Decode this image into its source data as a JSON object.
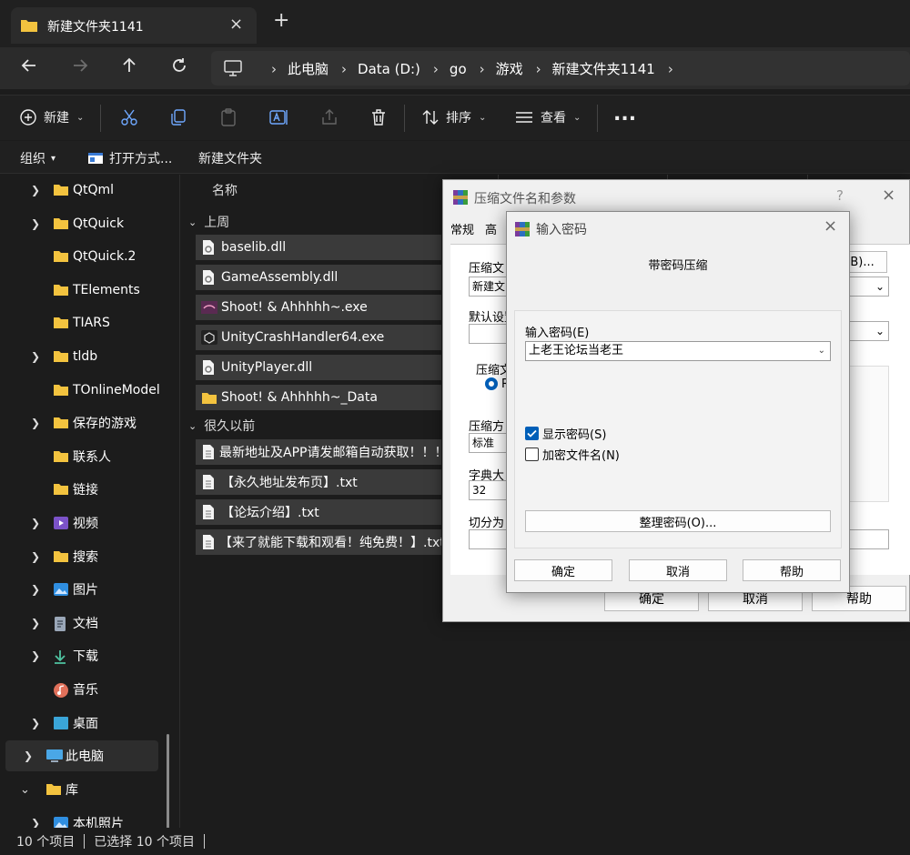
{
  "tab": {
    "title": "新建文件夹1141",
    "close_icon": "×",
    "new_icon": "+"
  },
  "address": {
    "crumbs": [
      "此电脑",
      "Data (D:)",
      "go",
      "游戏",
      "新建文件夹1141"
    ]
  },
  "commands": {
    "new": "新建",
    "sort": "排序",
    "view": "查看",
    "more": "..."
  },
  "subbar": {
    "organize": "组织",
    "open_with": "打开方式...",
    "new_folder": "新建文件夹"
  },
  "sidebar": {
    "items": [
      {
        "label": "QtQml",
        "expand": true,
        "icon": "folder-icon"
      },
      {
        "label": "QtQuick",
        "expand": true,
        "icon": "folder-icon"
      },
      {
        "label": "QtQuick.2",
        "expand": false,
        "icon": "folder-icon"
      },
      {
        "label": "TElements",
        "expand": false,
        "icon": "folder-icon"
      },
      {
        "label": "TIARS",
        "expand": false,
        "icon": "folder-icon"
      },
      {
        "label": "tldb",
        "expand": true,
        "icon": "folder-icon"
      },
      {
        "label": "TOnlineModel",
        "expand": false,
        "icon": "folder-icon"
      },
      {
        "label": "保存的游戏",
        "expand": true,
        "icon": "folder-icon"
      },
      {
        "label": "联系人",
        "expand": false,
        "icon": "folder-icon"
      },
      {
        "label": "链接",
        "expand": false,
        "icon": "folder-icon"
      },
      {
        "label": "视频",
        "expand": true,
        "icon": "video-icon"
      },
      {
        "label": "搜索",
        "expand": true,
        "icon": "folder-icon"
      },
      {
        "label": "图片",
        "expand": true,
        "icon": "pictures-icon"
      },
      {
        "label": "文档",
        "expand": true,
        "icon": "documents-icon"
      },
      {
        "label": "下载",
        "expand": true,
        "icon": "download-icon"
      },
      {
        "label": "音乐",
        "expand": false,
        "icon": "music-icon"
      },
      {
        "label": "桌面",
        "expand": true,
        "icon": "desktop-icon"
      }
    ],
    "this_pc": "此电脑",
    "library": "库",
    "camera_roll": "本机照片"
  },
  "list": {
    "column_name": "名称",
    "group_last_week": "上周",
    "group_long_ago": "很久以前",
    "last_week": [
      {
        "name": "baselib.dll",
        "icon": "dll-icon"
      },
      {
        "name": "GameAssembly.dll",
        "icon": "dll-icon"
      },
      {
        "name": "Shoot! & Ahhhhh~.exe",
        "icon": "exe-icon"
      },
      {
        "name": "UnityCrashHandler64.exe",
        "icon": "unity-icon"
      },
      {
        "name": "UnityPlayer.dll",
        "icon": "dll-icon"
      },
      {
        "name": "Shoot! & Ahhhhh~_Data",
        "icon": "folder-icon"
      }
    ],
    "long_ago": [
      {
        "name": "最新地址及APP请发邮箱自动获取！！！",
        "icon": "txt-icon"
      },
      {
        "name": "【永久地址发布页】.txt",
        "icon": "txt-icon"
      },
      {
        "name": "【论坛介绍】.txt",
        "icon": "txt-icon"
      },
      {
        "name": "【来了就能下载和观看！纯免费！】.txt",
        "icon": "txt-icon"
      }
    ]
  },
  "status": {
    "count": "10 个项目",
    "selected": "已选择 10 个项目"
  },
  "archive_dialog": {
    "title": "压缩文件名和参数",
    "help_q": "?",
    "close": "×",
    "tabs": [
      "常规",
      "高"
    ],
    "archive_name_label": "压缩文",
    "archive_name_value": "新建文",
    "browse_button": "(B)...",
    "default_profile_label": "默认设置",
    "format_label": "压缩文",
    "format_option": "R",
    "method_label": "压缩方",
    "method_value": "标准",
    "dict_label": "字典大",
    "dict_value": "32",
    "split_label": "切分为",
    "ok": "确定",
    "cancel": "取消",
    "help": "帮助"
  },
  "password_dialog": {
    "title": "输入密码",
    "close": "×",
    "heading": "带密码压缩",
    "pw_label": "输入密码(E)",
    "pw_value": "上老王论坛当老王",
    "show_password": "显示密码(S)",
    "show_password_checked": true,
    "encrypt_names": "加密文件名(N)",
    "encrypt_names_checked": false,
    "organize": "整理密码(O)...",
    "ok": "确定",
    "cancel": "取消",
    "help": "帮助"
  },
  "colors": {
    "folder": "#f3c33f",
    "accent": "#005fb8",
    "dark_bg": "#1c1c1c"
  }
}
